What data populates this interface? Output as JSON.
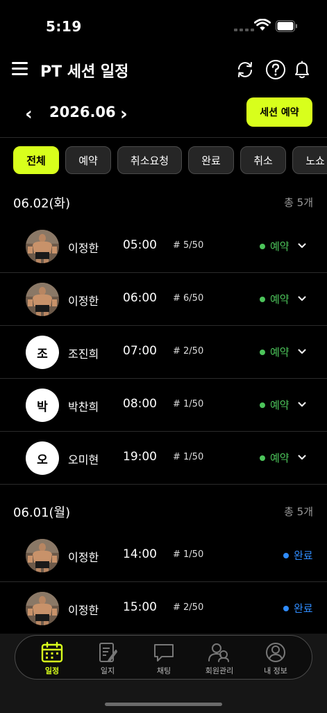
{
  "status_bar": {
    "time": "5:19"
  },
  "header": {
    "title": "PT 세션 일정"
  },
  "month_nav": {
    "month": "2026.06",
    "prev": "‹",
    "next": "›",
    "book_button": "세션 예약"
  },
  "filters": [
    {
      "label": "전체",
      "active": true
    },
    {
      "label": "예약",
      "active": false
    },
    {
      "label": "취소요청",
      "active": false
    },
    {
      "label": "완료",
      "active": false
    },
    {
      "label": "취소",
      "active": false
    },
    {
      "label": "노쇼",
      "active": false
    }
  ],
  "groups": [
    {
      "date": "06.02(화)",
      "total": "총 5개",
      "sessions": [
        {
          "name": "이정한",
          "time": "05:00",
          "count": "# 5/50",
          "status": "예약",
          "avatar": "photo",
          "initial": ""
        },
        {
          "name": "이정한",
          "time": "06:00",
          "count": "# 6/50",
          "status": "예약",
          "avatar": "photo",
          "initial": ""
        },
        {
          "name": "조진희",
          "time": "07:00",
          "count": "# 2/50",
          "status": "예약",
          "avatar": "letter",
          "initial": "조"
        },
        {
          "name": "박찬희",
          "time": "08:00",
          "count": "# 1/50",
          "status": "예약",
          "avatar": "letter",
          "initial": "박"
        },
        {
          "name": "오미현",
          "time": "19:00",
          "count": "# 1/50",
          "status": "예약",
          "avatar": "letter",
          "initial": "오"
        }
      ]
    },
    {
      "date": "06.01(월)",
      "total": "총 5개",
      "sessions": [
        {
          "name": "이정한",
          "time": "14:00",
          "count": "# 1/50",
          "status": "완료",
          "avatar": "photo",
          "initial": ""
        },
        {
          "name": "이정한",
          "time": "15:00",
          "count": "# 2/50",
          "status": "완료",
          "avatar": "photo",
          "initial": ""
        }
      ]
    }
  ],
  "status_colors": {
    "예약": "#4cc45a",
    "완료": "#2f8cff"
  },
  "accent_color": "#d8ff1c",
  "bottom_nav": [
    {
      "label": "일정",
      "icon": "calendar-icon",
      "active": true
    },
    {
      "label": "일지",
      "icon": "journal-icon",
      "active": false
    },
    {
      "label": "채팅",
      "icon": "chat-icon",
      "active": false
    },
    {
      "label": "회원관리",
      "icon": "members-icon",
      "active": false
    },
    {
      "label": "내 정보",
      "icon": "profile-icon",
      "active": false
    }
  ]
}
